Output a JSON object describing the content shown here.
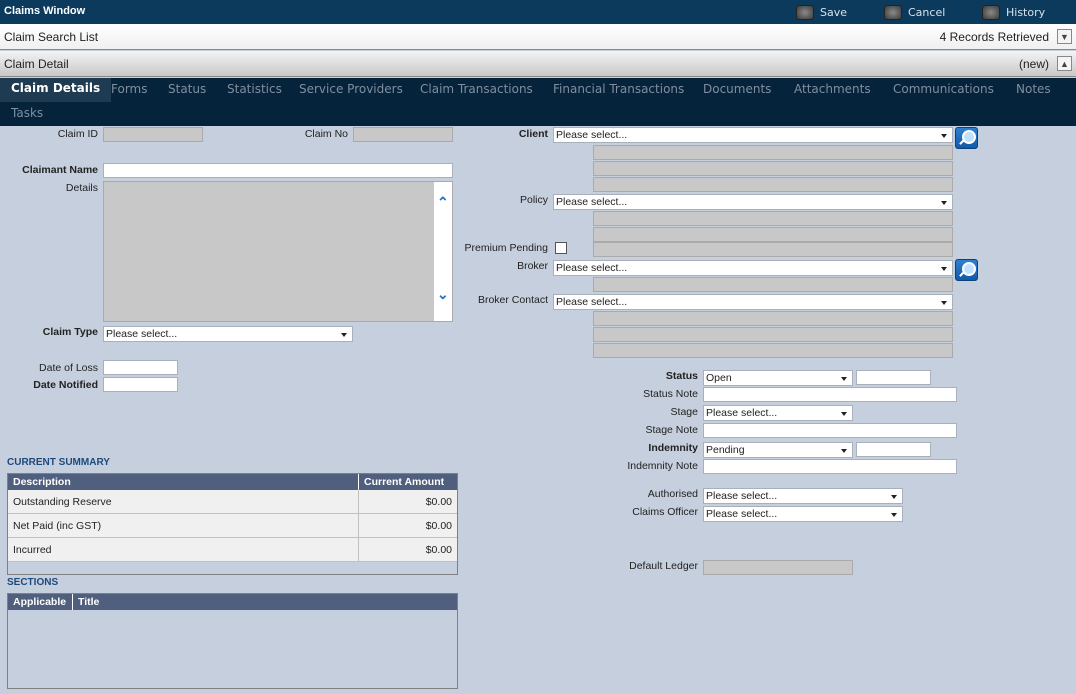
{
  "window": {
    "title": "Claims Window",
    "buttons": [
      {
        "label": "Save"
      },
      {
        "label": "Cancel"
      },
      {
        "label": "History"
      }
    ]
  },
  "search_bar": {
    "title": "Claim Search List",
    "status": "4 Records Retrieved"
  },
  "detail_bar": {
    "title": "Claim Detail",
    "status": "(new)"
  },
  "tabs": [
    {
      "label": "Claim Details",
      "active": true
    },
    {
      "label": "Forms"
    },
    {
      "label": "Status"
    },
    {
      "label": "Statistics"
    },
    {
      "label": "Service Providers"
    },
    {
      "label": "Claim Transactions"
    },
    {
      "label": "Financial Transactions"
    },
    {
      "label": "Documents"
    },
    {
      "label": "Attachments"
    },
    {
      "label": "Communications"
    },
    {
      "label": "Notes"
    },
    {
      "label": "Tasks"
    }
  ],
  "form": {
    "claim_id": "Claim ID",
    "claim_no": "Claim No",
    "claimant_name": "Claimant Name",
    "details": "Details",
    "claim_type": "Claim Type",
    "claim_type_value": "Please select...",
    "date_of_loss": "Date of Loss",
    "date_notified": "Date Notified",
    "client": "Client",
    "client_value": "Please select...",
    "policy": "Policy",
    "policy_value": "Please select...",
    "premium_pending": "Premium Pending",
    "premium_pending_checked": false,
    "broker": "Broker",
    "broker_value": "Please select...",
    "broker_contact": "Broker Contact",
    "broker_contact_value": "Please select...",
    "status": "Status",
    "status_value": "Open",
    "status_note": "Status Note",
    "stage": "Stage",
    "stage_value": "Please select...",
    "stage_note": "Stage Note",
    "indemnity": "Indemnity",
    "indemnity_value": "Pending",
    "indemnity_note": "Indemnity Note",
    "authorised": "Authorised",
    "authorised_value": "Please select...",
    "claims_officer": "Claims Officer",
    "claims_officer_value": "Please select...",
    "default_ledger": "Default Ledger"
  },
  "summary": {
    "title": "CURRENT SUMMARY",
    "columns": [
      "Description",
      "Current Amount"
    ],
    "rows": [
      [
        "Outstanding Reserve",
        "$0.00"
      ],
      [
        "Net Paid (inc GST)",
        "$0.00"
      ],
      [
        "Incurred",
        "$0.00"
      ]
    ]
  },
  "sections": {
    "title": "SECTIONS",
    "columns": [
      "Applicable",
      "Title"
    ]
  },
  "colors": {
    "title_bar": "#0b3a5c",
    "tab_bar": "#05233a",
    "background": "#c6cfdd",
    "table_header": "#4f5f7d"
  }
}
